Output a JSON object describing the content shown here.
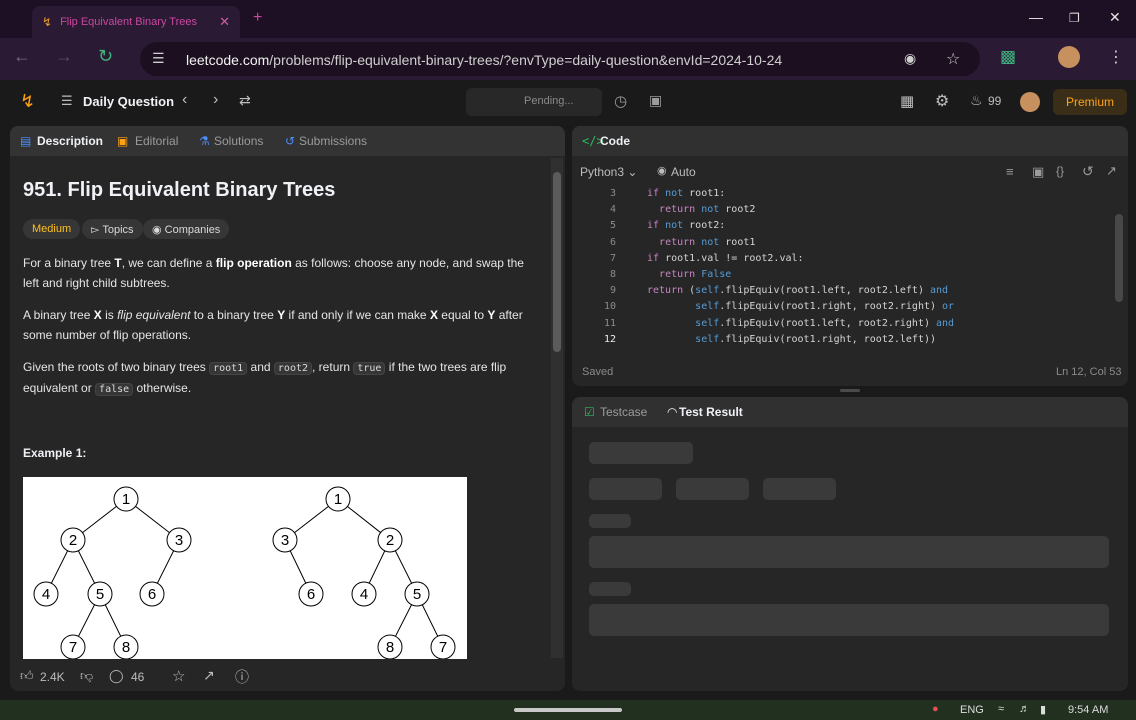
{
  "browser": {
    "tab_title": "Flip Equivalent Binary Trees",
    "url_host": "leetcode.com",
    "url_path": "/problems/flip-equivalent-binary-trees/?envType=daily-question&envId=2024-10-24"
  },
  "header": {
    "daily_question": "Daily Question",
    "pending": "Pending...",
    "streak": "99",
    "premium": "Premium"
  },
  "left_tabs": [
    "Description",
    "Editorial",
    "Solutions",
    "Submissions"
  ],
  "problem": {
    "title": "951. Flip Equivalent Binary Trees",
    "difficulty": "Medium",
    "topics": "Topics",
    "companies": "Companies",
    "p1": {
      "a": "For a binary tree ",
      "b": "T",
      "c": ", we can define a ",
      "d": "flip operation",
      "e": " as follows: choose any node, and swap the left and right child subtrees."
    },
    "p2": {
      "a": "A binary tree ",
      "b": "X",
      "c": " is ",
      "d": "flip equivalent",
      "e": " to a binary tree ",
      "f": "Y",
      "g": " if and only if we can make ",
      "h": "X",
      "i": " equal to ",
      "j": "Y",
      "k": " after some number of flip operations."
    },
    "p3": {
      "a": "Given the roots of two binary trees ",
      "b": "root1",
      "c": " and ",
      "d": "root2",
      "e": ", return ",
      "f": "true",
      "g": " if the two trees are flip equivalent or ",
      "h": "false",
      "i": " otherwise."
    },
    "example_label": "Example 1:",
    "tree1_nodes": [
      "1",
      "2",
      "3",
      "4",
      "5",
      "6",
      "7",
      "8"
    ],
    "tree2_nodes": [
      "1",
      "3",
      "2",
      "6",
      "4",
      "5",
      "8",
      "7"
    ]
  },
  "bottom": {
    "likes": "2.4K",
    "comments": "46"
  },
  "code": {
    "tab": "Code",
    "language": "Python3",
    "mode": "Auto",
    "line_numbers": [
      "3",
      "4",
      "5",
      "6",
      "7",
      "8",
      "9",
      "10",
      "11",
      "12"
    ],
    "lines": [
      "if not root1:",
      "  return not root2",
      "if not root2:",
      "  return not root1",
      "if root1.val != root2.val:",
      "  return False",
      "return (self.flipEquiv(root1.left, root2.left) and",
      "        self.flipEquiv(root1.right, root2.right) or",
      "        self.flipEquiv(root1.left, root2.right) and",
      "        self.flipEquiv(root1.right, root2.left))"
    ],
    "status": "Saved",
    "cursor": "Ln 12, Col 53"
  },
  "test": {
    "testcase_tab": "Testcase",
    "result_tab": "Test Result"
  },
  "taskbar": {
    "lang": "ENG",
    "time": "9:54 AM"
  },
  "colors": {
    "accent_orange": "#ffa116",
    "medium_yellow": "#ffc01e",
    "browser_purple": "#2b1a33"
  }
}
